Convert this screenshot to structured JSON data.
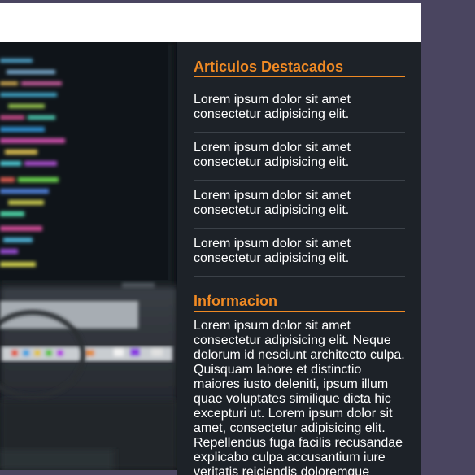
{
  "header": {
    "background": "#ffffff"
  },
  "hero": {
    "alt": "code on monitor blurred photo",
    "icon": "image-icon"
  },
  "sidebar": {
    "featured": {
      "title": "Articulos Destacados",
      "items": [
        {
          "text": "Lorem ipsum dolor sit amet consectetur adipisicing elit."
        },
        {
          "text": "Lorem ipsum dolor sit amet consectetur adipisicing elit."
        },
        {
          "text": "Lorem ipsum dolor sit amet consectetur adipisicing elit."
        },
        {
          "text": "Lorem ipsum dolor sit amet consectetur adipisicing elit."
        }
      ]
    },
    "info": {
      "title": "Informacion",
      "text": "Lorem ipsum dolor sit amet consectetur adipisicing elit. Neque dolorum id nesciunt architecto culpa. Quisquam labore et distinctio maiores iusto deleniti, ipsum illum quae voluptates similique dicta hic excepturi ut. Lorem ipsum dolor sit amet, consectetur adipisicing elit. Repellendus fuga facilis recusandae explicabo culpa accusantium iure veritatis reiciendis doloremque"
    }
  },
  "colors": {
    "accent": "#f08a24",
    "sidebar_bg": "#1d2228",
    "page_bg": "#4a4560",
    "text": "#ffffff"
  }
}
